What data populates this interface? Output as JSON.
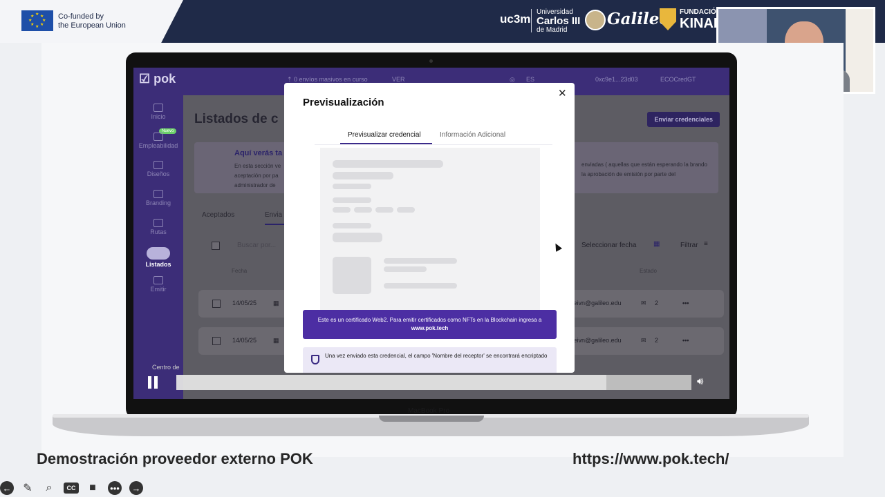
{
  "banner": {
    "eu_line1": "Co-funded by",
    "eu_line2": "the European Union",
    "uc3m": "uc3m",
    "carlos_line1": "Universidad",
    "carlos_line2": "Carlos III",
    "carlos_line3": "de Madrid",
    "galileo": "Galileo",
    "kinal_line1": "FUNDACIÓ",
    "kinal_line2": "KINAL"
  },
  "app": {
    "logo": "☑ pok",
    "header": {
      "uploads": "⇡ 0 envíos masivos en curso",
      "ver": "VER",
      "lang": "ES",
      "wallet": "0xc9e1...23d03",
      "org": "ECOCredGT"
    },
    "sidebar": {
      "items": [
        {
          "label": "Inicio"
        },
        {
          "label": "Empleabilidad"
        },
        {
          "label": "Diseños"
        },
        {
          "label": "Branding"
        },
        {
          "label": "Rutas"
        },
        {
          "label": "Listados"
        },
        {
          "label": "Emitir"
        }
      ],
      "new_badge": "Nuevo"
    },
    "page_title": "Listados de c",
    "send_button": "Enviar credenciales",
    "info": {
      "title": "Aquí verás ta",
      "left_text": "En esta sección ve aceptación por pa administrador de",
      "right_text": "enviadas ( aquellas que están esperando la brando la aprobación de emisión por parte del"
    },
    "tabs": [
      "Aceptados",
      "Envia"
    ],
    "toolbar": {
      "search_placeholder": "Buscar por...",
      "date": "Seleccionar fecha",
      "filter": "Filtrar"
    },
    "columns": {
      "date": "Fecha",
      "status": "Estado"
    },
    "rows": [
      {
        "date": "14/05/25",
        "email": "teivn@galileo.edu",
        "count": "2"
      },
      {
        "date": "14/05/25",
        "email": "teivn@galileo.edu",
        "count": "2"
      }
    ]
  },
  "modal": {
    "title": "Previsualización",
    "tabs": [
      "Previsualizar credencial",
      "Información Adicional"
    ],
    "notice_web2_pre": "Este es un certificado Web2. Para emitir certificados como NFTs en la Blockchain ingresa a",
    "notice_web2_link": "www.pok.tech",
    "notice_encrypt": "Una vez enviado esta credencial, el campo 'Nombre del receptor' se encontrará encriptado"
  },
  "video": {
    "help_label": "Centro de",
    "progress": 0.835
  },
  "laptop_label": "MacBook Pro",
  "caption_left": "Demostración proveedor externo POK",
  "caption_right": "https://www.pok.tech/",
  "colors": {
    "primary": "#4c2ea3",
    "banner": "#1f2a48",
    "sidebar": "#3c2d78"
  }
}
